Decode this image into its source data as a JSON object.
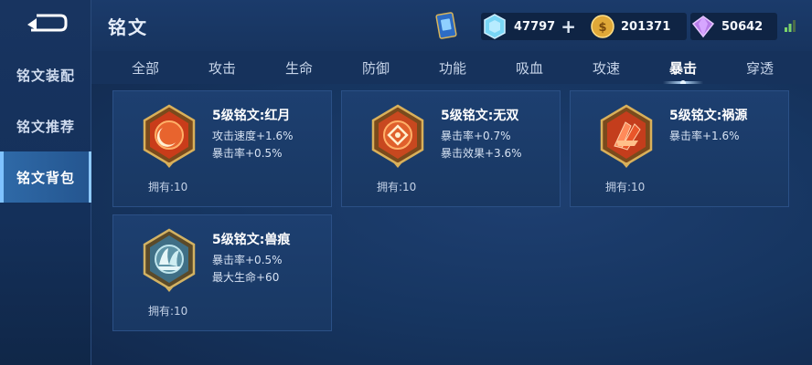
{
  "sidebar": {
    "items": [
      {
        "label": "铭文装配",
        "active": false
      },
      {
        "label": "铭文推荐",
        "active": false
      },
      {
        "label": "铭文背包",
        "active": true
      }
    ]
  },
  "header": {
    "title": "铭文",
    "currencies": {
      "diamond": "47797",
      "gold": "201371",
      "gem": "50642"
    },
    "add_symbol": "+"
  },
  "tabs": [
    "全部",
    "攻击",
    "生命",
    "防御",
    "功能",
    "吸血",
    "攻速",
    "暴击",
    "穿透"
  ],
  "active_tab": "暴击",
  "runes": [
    {
      "name": "5级铭文:红月",
      "stats": [
        "攻击速度+1.6%",
        "暴击率+0.5%"
      ],
      "owned": "拥有:10",
      "icon": "red-moon-rune-icon"
    },
    {
      "name": "5级铭文:无双",
      "stats": [
        "暴击率+0.7%",
        "暴击效果+3.6%"
      ],
      "owned": "拥有:10",
      "icon": "unrivaled-rune-icon"
    },
    {
      "name": "5级铭文:祸源",
      "stats": [
        "暴击率+1.6%"
      ],
      "owned": "拥有:10",
      "icon": "calamity-rune-icon"
    },
    {
      "name": "5级铭文:兽痕",
      "stats": [
        "暴击率+0.5%",
        "最大生命+60"
      ],
      "owned": "拥有:10",
      "icon": "beast-mark-rune-icon"
    }
  ],
  "colors": {
    "red_rune": "#d2481f",
    "teal_rune": "#8fc3c9",
    "gold_frame": "#c9a24a",
    "active_tab": "#ffffff"
  }
}
